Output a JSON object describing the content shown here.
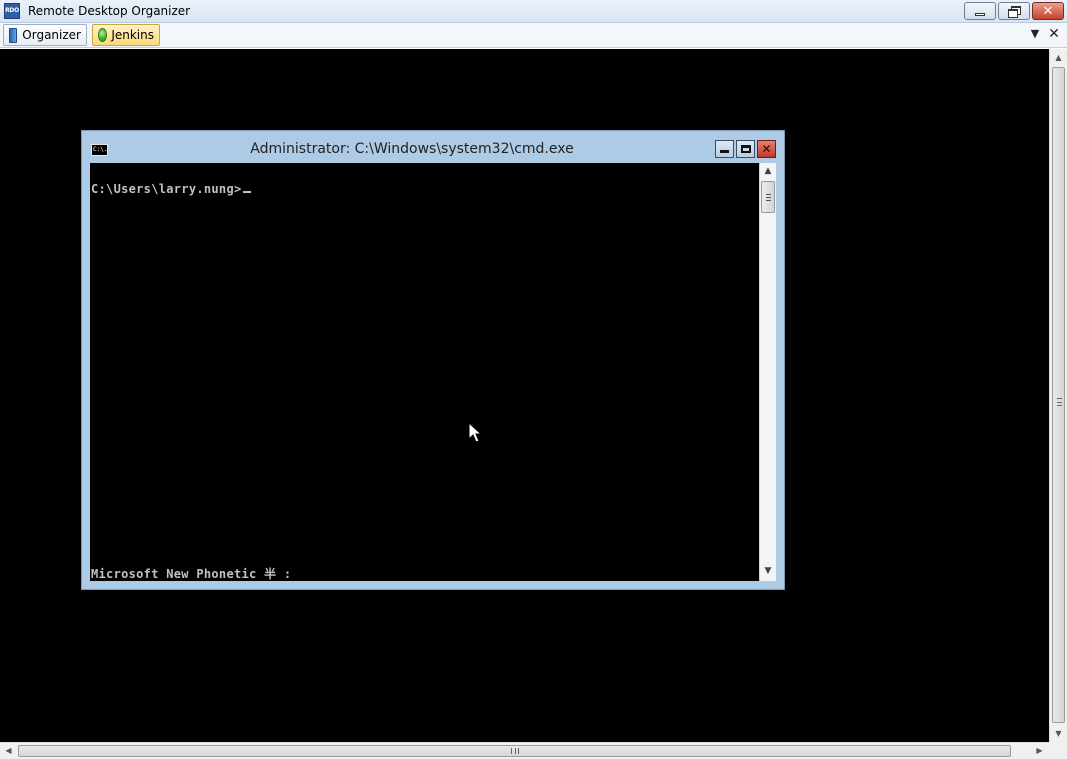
{
  "app": {
    "title": "Remote Desktop Organizer",
    "icon_label": "RDO",
    "icon": "rdo-app-icon"
  },
  "window_controls": {
    "minimize_icon": "minimize-icon",
    "restore_icon": "restore-icon",
    "close_icon": "close-icon",
    "close_glyph": "✕"
  },
  "tabs": [
    {
      "label": "Organizer",
      "icon": "book-icon",
      "active": false
    },
    {
      "label": "Jenkins",
      "icon": "green-status-icon",
      "active": true,
      "accent": "#fbd97a"
    }
  ],
  "tabstrip": {
    "dropdown_glyph": "▼",
    "close_glyph": "✕"
  },
  "cmd_window": {
    "title": "Administrator: C:\\Windows\\system32\\cmd.exe",
    "icon_label": "C:\\.",
    "close_glyph": "✕",
    "console_lines": {
      "prompt": "C:\\Users\\larry.nung>",
      "ime_status": "Microsoft New Phonetic 半 :"
    }
  },
  "scroll_arrows": {
    "up": "▲",
    "down": "▼",
    "left": "◀",
    "right": "▶"
  },
  "colors": {
    "remote_background": "#000000",
    "console_text": "#c0c0c0",
    "cmd_frame": "#aecbe6"
  }
}
